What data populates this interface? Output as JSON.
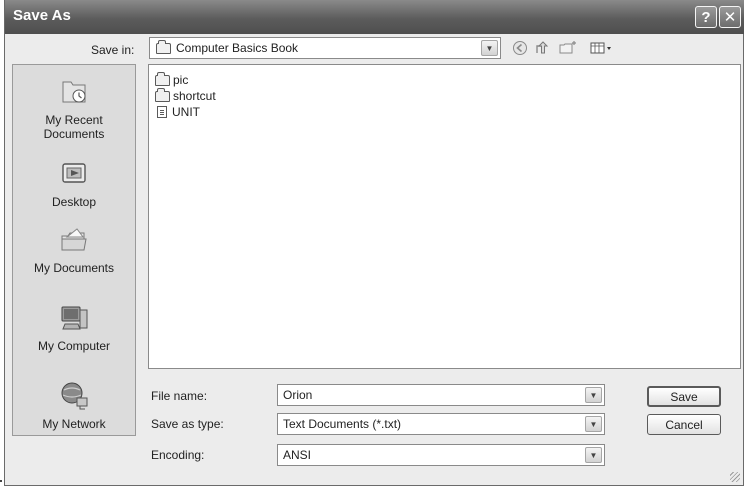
{
  "window": {
    "title": "Save As",
    "help_glyph": "?",
    "close_glyph": "✕"
  },
  "save_in": {
    "label": "Save in:",
    "value": "Computer Basics Book",
    "icon": "folder-icon"
  },
  "toolbar_icons": [
    "back-icon",
    "up-folder-icon",
    "new-folder-icon",
    "views-menu-icon"
  ],
  "places": [
    {
      "label": "My Recent\nDocuments",
      "icon": "recent-documents-icon"
    },
    {
      "label": "Desktop",
      "icon": "desktop-icon"
    },
    {
      "label": "My Documents",
      "icon": "my-documents-icon"
    },
    {
      "label": "My Computer",
      "icon": "my-computer-icon"
    },
    {
      "label": "My Network",
      "icon": "my-network-icon"
    }
  ],
  "files": [
    {
      "name": "pic",
      "type": "folder"
    },
    {
      "name": "shortcut",
      "type": "folder"
    },
    {
      "name": "UNIT",
      "type": "text-file"
    }
  ],
  "fields": {
    "file_name": {
      "label": "File name:",
      "value": "Orion"
    },
    "save_as_type": {
      "label": "Save as type:",
      "value": "Text Documents (*.txt)"
    },
    "encoding": {
      "label": "Encoding:",
      "value": "ANSI"
    }
  },
  "buttons": {
    "save": "Save",
    "cancel": "Cancel"
  },
  "colors": {
    "titlebar": "#5c5c5c",
    "dialog_bg": "#ececec"
  }
}
